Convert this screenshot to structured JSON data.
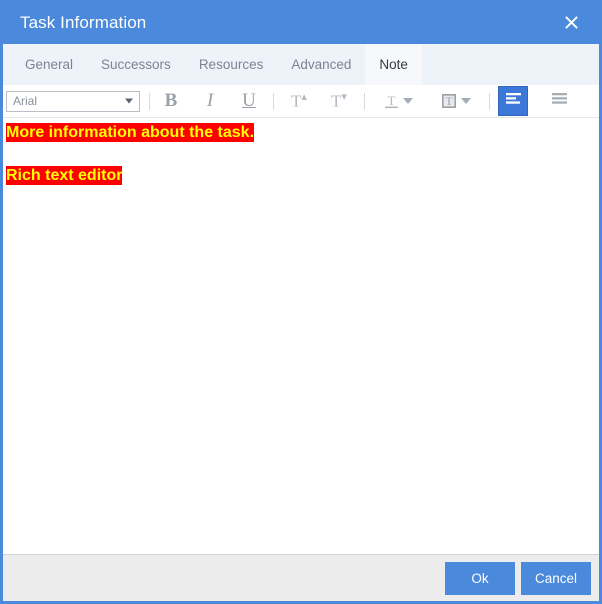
{
  "window": {
    "title": "Task Information",
    "close_icon": "close-icon",
    "accent_color": "#4a89dc"
  },
  "tabs": [
    {
      "label": "General",
      "active": false
    },
    {
      "label": "Successors",
      "active": false
    },
    {
      "label": "Resources",
      "active": false
    },
    {
      "label": "Advanced",
      "active": false
    },
    {
      "label": "Note",
      "active": true
    }
  ],
  "toolbar": {
    "font_family_value": "Arial",
    "buttons": [
      {
        "name": "bold-button",
        "label": "B",
        "icon": "bold-icon",
        "active": false
      },
      {
        "name": "italic-button",
        "label": "I",
        "icon": "italic-icon",
        "active": false
      },
      {
        "name": "underline-button",
        "label": "U",
        "icon": "underline-icon",
        "active": false
      },
      {
        "name": "increase-font-size-button",
        "label": "T",
        "icon": "font-size-increase-icon",
        "active": false
      },
      {
        "name": "decrease-font-size-button",
        "label": "T",
        "icon": "font-size-decrease-icon",
        "active": false
      },
      {
        "name": "text-color-button",
        "label": "T",
        "icon": "text-color-icon",
        "active": false
      },
      {
        "name": "highlight-color-button",
        "label": "T",
        "icon": "highlight-color-icon",
        "active": false
      },
      {
        "name": "align-left-button",
        "label": "",
        "icon": "align-left-icon",
        "active": true
      },
      {
        "name": "align-justify-button",
        "label": "",
        "icon": "align-justify-icon",
        "active": false
      }
    ]
  },
  "note": {
    "lines": [
      "More information about the task.",
      "Rich text editor"
    ],
    "text_color": "#ffff00",
    "highlight_color": "#ff0000"
  },
  "footer": {
    "ok_label": "Ok",
    "cancel_label": "Cancel"
  }
}
